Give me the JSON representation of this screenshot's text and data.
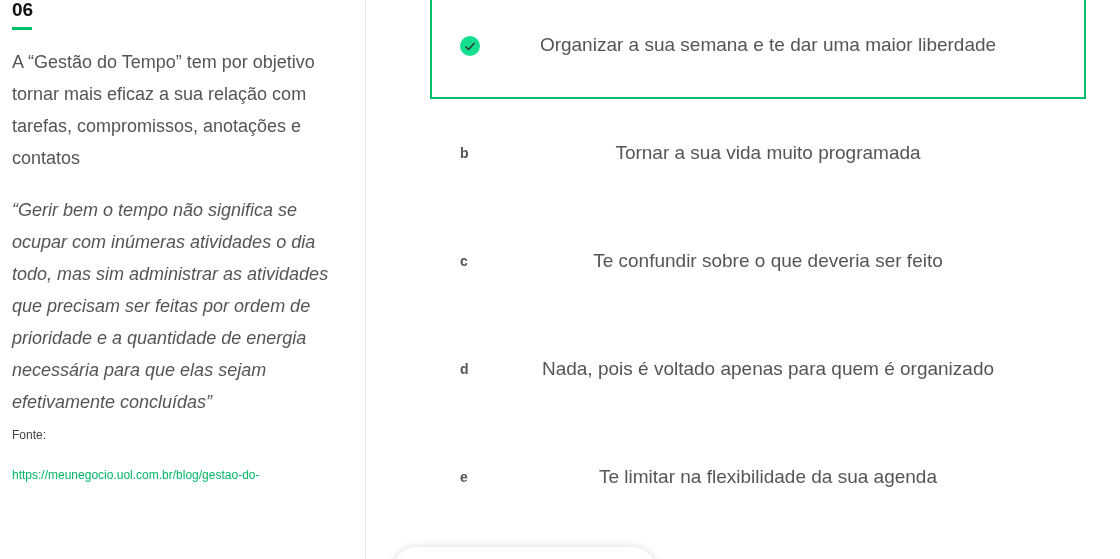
{
  "sidebar": {
    "number": "06",
    "paragraph": "A “Gestão do Tempo” tem por objetivo tornar mais eficaz a sua relação com tarefas, compromissos, anotações e contatos",
    "quote": "“Gerir bem o tempo não significa se ocupar com inúmeras atividades o dia todo, mas sim administrar as atividades que precisam ser feitas por ordem de prioridade e a quantidade de energia necessária para que elas sejam efetivamente concluídas”",
    "source_label": "Fonte:",
    "source_link": "https://meunegocio.uol.com.br/blog/gestao-do-"
  },
  "options": [
    {
      "text": "Organizar a sua semana e te dar uma maior liberdade",
      "selected": true
    },
    {
      "letter": "b",
      "text": "Tornar a sua vida muito programada",
      "selected": false
    },
    {
      "letter": "c",
      "text": "Te confundir sobre o que deveria ser feito",
      "selected": false
    },
    {
      "letter": "d",
      "text": "Nada, pois é voltado apenas para quem é organizado",
      "selected": false
    },
    {
      "letter": "e",
      "text": "Te limitar na flexibilidade da sua agenda",
      "selected": false
    }
  ]
}
